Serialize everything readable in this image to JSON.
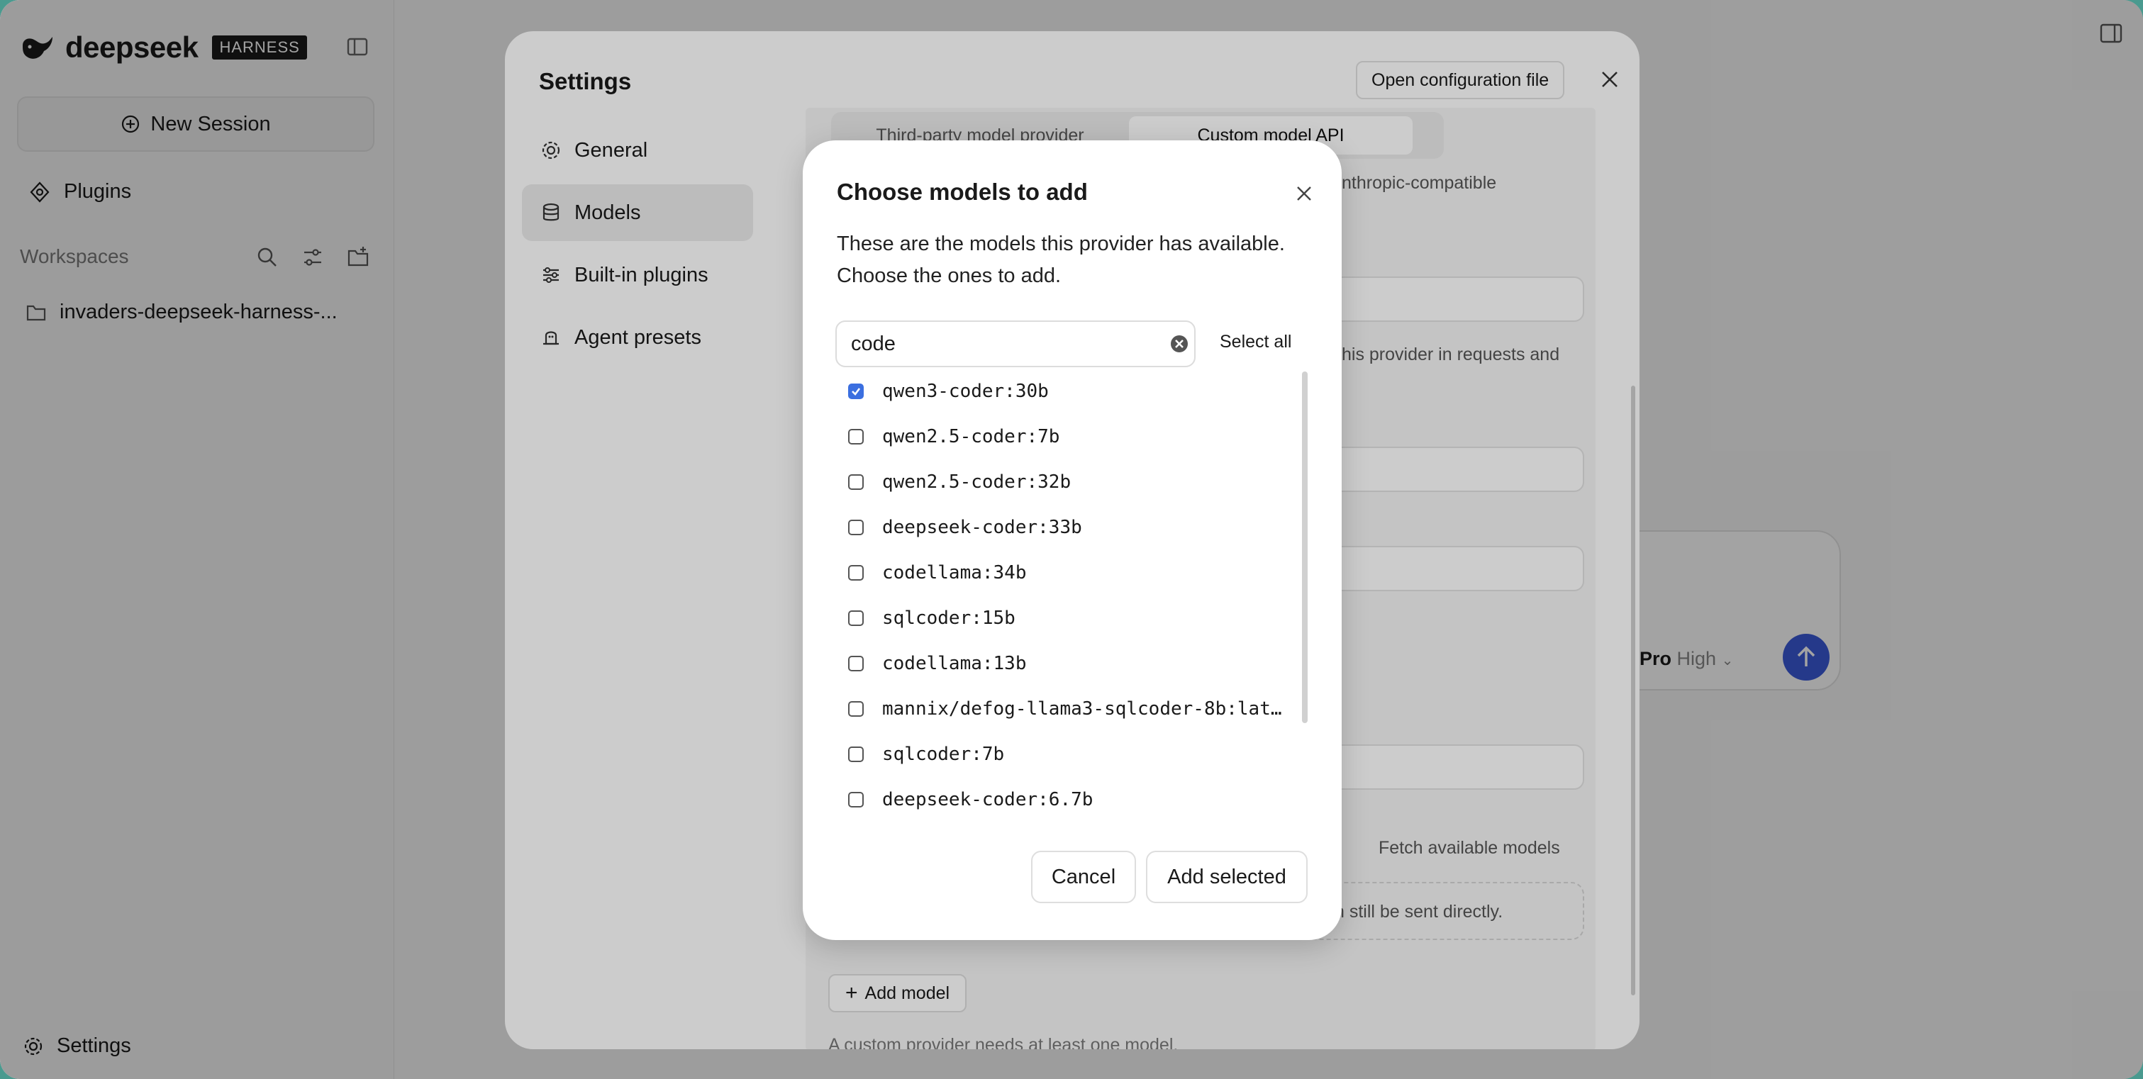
{
  "sidebar": {
    "brand_name": "deepseek",
    "brand_badge": "HARNESS",
    "new_session_label": "New Session",
    "plugins_label": "Plugins",
    "workspaces_label": "Workspaces",
    "workspace_item": "invaders-deepseek-harness-...",
    "settings_label": "Settings"
  },
  "composer": {
    "model_label": "Pro",
    "effort_label": "High"
  },
  "settings_panel": {
    "title": "Settings",
    "open_config_label": "Open configuration file",
    "nav": [
      {
        "label": "General",
        "icon": "gear-icon"
      },
      {
        "label": "Models",
        "icon": "database-icon"
      },
      {
        "label": "Built-in plugins",
        "icon": "sliders-icon"
      },
      {
        "label": "Agent presets",
        "icon": "agent-icon"
      }
    ],
    "segment_options": [
      "Third-party model provider",
      "Custom model API"
    ],
    "active_segment": "Custom model API",
    "background_text": {
      "compatible_hint": "nthropic-compatible",
      "requests_hint": "his provider in requests and",
      "fetch_models": "Fetch available models",
      "sent_directly": "n still be sent directly.",
      "add_model": "Add model",
      "needs_model": "A custom provider needs at least one model."
    }
  },
  "modal": {
    "title": "Choose models to add",
    "description": "These are the models this provider has available. Choose the ones to add.",
    "search_value": "code",
    "select_all_label": "Select all",
    "models": [
      {
        "name": "qwen3-coder:30b",
        "checked": true
      },
      {
        "name": "qwen2.5-coder:7b",
        "checked": false
      },
      {
        "name": "qwen2.5-coder:32b",
        "checked": false
      },
      {
        "name": "deepseek-coder:33b",
        "checked": false
      },
      {
        "name": "codellama:34b",
        "checked": false
      },
      {
        "name": "sqlcoder:15b",
        "checked": false
      },
      {
        "name": "codellama:13b",
        "checked": false
      },
      {
        "name": "mannix/defog-llama3-sqlcoder-8b:lat…",
        "checked": false
      },
      {
        "name": "sqlcoder:7b",
        "checked": false
      },
      {
        "name": "deepseek-coder:6.7b",
        "checked": false
      }
    ],
    "cancel_label": "Cancel",
    "add_selected_label": "Add selected"
  },
  "colors": {
    "accent": "#3b6fe0",
    "send_button": "#3b5bd9",
    "wallpaper": "#4a9a8f"
  }
}
